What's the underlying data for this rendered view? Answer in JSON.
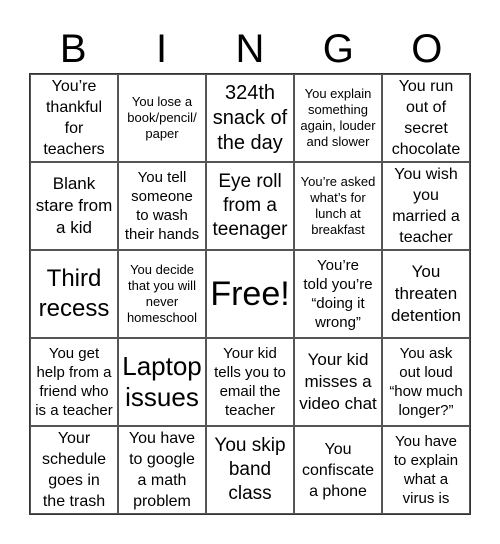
{
  "header": {
    "letters": [
      "B",
      "I",
      "N",
      "G",
      "O"
    ]
  },
  "cells": [
    "You’re\nthankful\nfor\nteachers",
    "You lose a\nbook/pencil/\npaper",
    "324th\nsnack of\nthe day",
    "You explain\nsomething\nagain, louder\nand slower",
    "You run\nout of\nsecret\nchocolate",
    "Blank\nstare from\na kid",
    "You tell\nsomeone\nto wash\ntheir hands",
    "Eye roll\nfrom a\nteenager",
    "You’re asked\nwhat’s for\nlunch at\nbreakfast",
    "You wish\nyou\nmarried a\nteacher",
    "Third\nrecess",
    "You decide\nthat you will\nnever\nhomeschool",
    "Free!",
    "You’re\ntold you’re\n“doing it\nwrong”",
    "You\nthreaten\ndetention",
    "You get\nhelp from a\nfriend who\nis a teacher",
    "Laptop\nissues",
    "Your kid\ntells you to\nemail the\nteacher",
    "Your kid\nmisses a\nvideo chat",
    "You ask\nout loud\n“how much\nlonger?”",
    "Your\nschedule\ngoes in\nthe trash",
    "You have\nto google\na math\nproblem",
    "You skip\nband\nclass",
    "You\nconfiscate\na phone",
    "You have\nto explain\nwhat a\nvirus is"
  ]
}
